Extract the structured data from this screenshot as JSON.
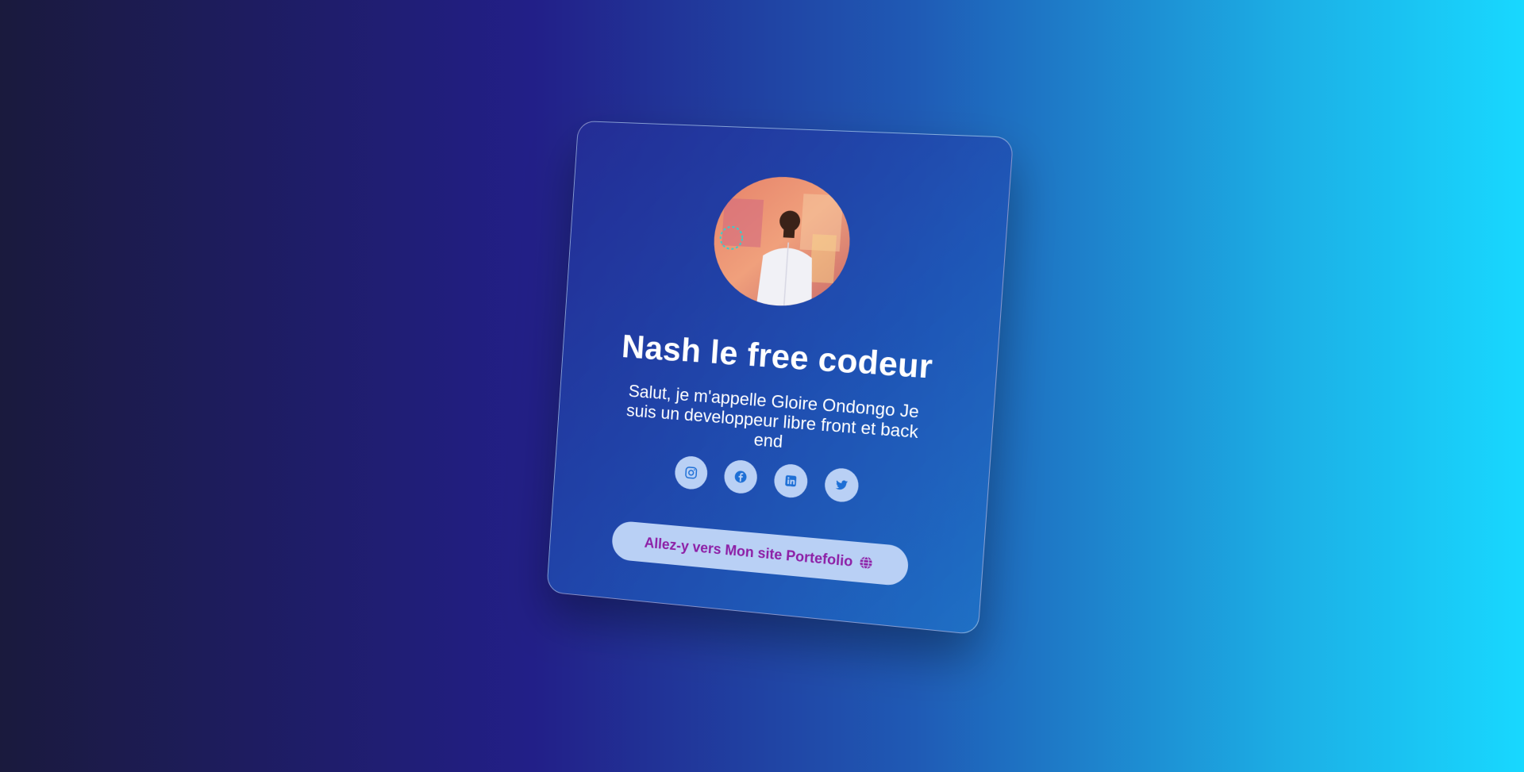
{
  "profile": {
    "name": "Nash le free codeur",
    "bio": "Salut, je m'appelle Gloire Ondongo Je suis un developpeur libre front et back end"
  },
  "socials": [
    {
      "icon": "instagram-icon"
    },
    {
      "icon": "facebook-icon"
    },
    {
      "icon": "linkedin-icon"
    },
    {
      "icon": "twitter-icon"
    }
  ],
  "cta": {
    "label": "Allez-y vers Mon site Portefolio",
    "icon": "globe-icon"
  },
  "colors": {
    "accent_text": "#8d1fa6",
    "button_bg": "#b9d0f5",
    "social_icon": "#1d6fd6"
  }
}
